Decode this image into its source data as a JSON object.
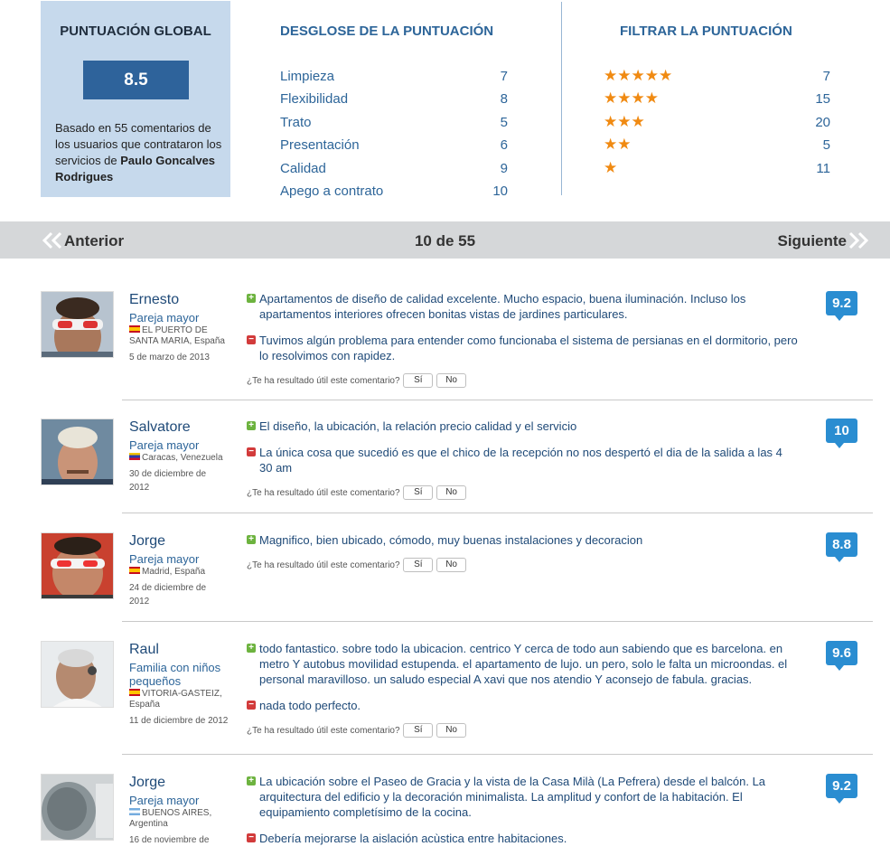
{
  "summary": {
    "global_title": "PUNTUACIÓN GLOBAL",
    "global_score": "8.5",
    "global_desc": "Basado en 55 comentarios de los usuarios que contrataron los servicios de",
    "provider_name": "Paulo Goncalves Rodrigues"
  },
  "breakdown": {
    "title": "DESGLOSE DE LA PUNTUACIÓN",
    "rows": [
      {
        "label": "Limpieza",
        "value": "7"
      },
      {
        "label": "Flexibilidad",
        "value": "8"
      },
      {
        "label": "Trato",
        "value": "5"
      },
      {
        "label": "Presentación",
        "value": "6"
      },
      {
        "label": "Calidad",
        "value": "9"
      },
      {
        "label": "Apego a contrato",
        "value": "10"
      }
    ]
  },
  "filter": {
    "title": "FILTRAR LA PUNTUACIÓN",
    "rows": [
      {
        "stars": "★★★★★",
        "count": "7"
      },
      {
        "stars": "★★★★",
        "count": "15"
      },
      {
        "stars": "★★★",
        "count": "20"
      },
      {
        "stars": "★★",
        "count": "5"
      },
      {
        "stars": "★",
        "count": "11"
      }
    ]
  },
  "pager": {
    "prev_label": "Anterior",
    "next_label": "Siguiente",
    "count_label": "10 de 55"
  },
  "helpful_prompt": "¿Te ha resultado útil este comentario?",
  "yes_label": "Sí",
  "no_label": "No",
  "reviews": [
    {
      "name": "Ernesto",
      "type": "Pareja mayor",
      "location": "EL PUERTO DE SANTA MARIA, España",
      "date": "5 de marzo de 2013",
      "score": "9.2",
      "positive": "Apartamentos de diseño de calidad excelente. Mucho espacio, buena iluminación. Incluso los apartamentos interiores ofrecen bonitas vistas de jardines particulares.",
      "negative": "Tuvimos algún problema para entender como funcionaba el sistema de persianas en el dormitorio, pero lo resolvimos con rapidez."
    },
    {
      "name": "Salvatore",
      "type": "Pareja mayor",
      "location": "Caracas, Venezuela",
      "date": "30 de diciembre de 2012",
      "score": "10",
      "positive": "El diseño, la ubicación, la relación precio calidad y el servicio",
      "negative": "La única cosa que sucedió es que el chico de la recepción no nos despertó el dia de la salida a las 4 30 am"
    },
    {
      "name": "Jorge",
      "type": "Pareja mayor",
      "location": "Madrid, España",
      "date": "24 de diciembre de 2012",
      "score": "8.8",
      "positive": "Magnifico, bien ubicado, cómodo, muy buenas instalaciones y decoracion"
    },
    {
      "name": "Raul",
      "type": "Familia con niños pequeños",
      "location": "VITORIA-GASTEIZ, España",
      "date": "11 de diciembre de 2012",
      "score": "9.6",
      "positive": "todo fantastico. sobre todo la ubicacion. centrico Y cerca de todo aun sabiendo que es barcelona. en metro Y autobus movilidad estupenda. el apartamento de lujo. un pero, solo le falta un microondas. el personal maravilloso. un saludo especial A xavi que nos atendio Y aconsejo de fabula. gracias.",
      "negative": "nada todo perfecto."
    },
    {
      "name": "Jorge",
      "type": "Pareja mayor",
      "location": "BUENOS AIRES, Argentina",
      "date": "16 de noviembre de",
      "score": "9.2",
      "positive": "La ubicación sobre el Paseo de Gracia y la vista de la Casa Milà (La Pefrera) desde el balcón. La arquitectura del edificio y la decoración minimalista. La amplitud y confort de la habitación. El equipamiento completísimo de la cocina.",
      "negative": "Debería mejorarse la aislación acùstica entre habitaciones."
    }
  ]
}
